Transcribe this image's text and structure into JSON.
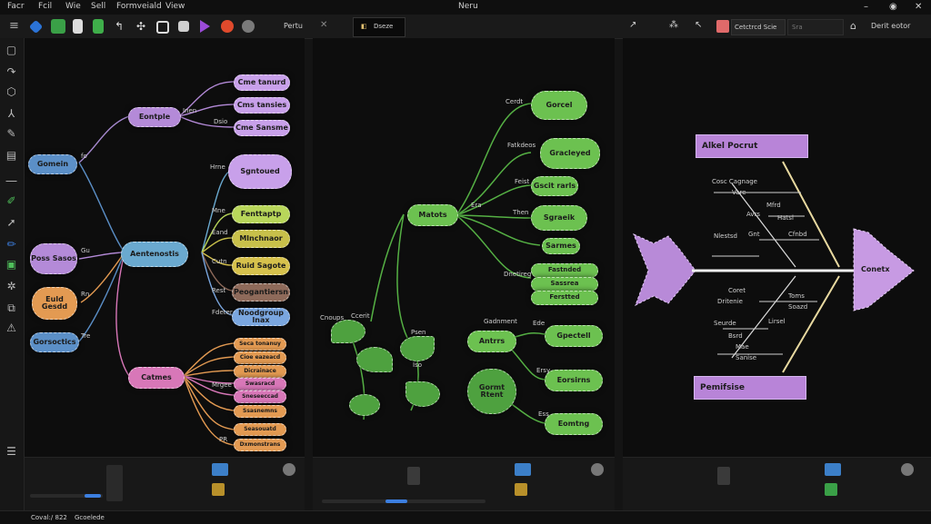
{
  "window": {
    "title": "Neru"
  },
  "menu": [
    "Facr",
    "Fcil",
    "Wie",
    "Sell",
    "Formveiald",
    "View"
  ],
  "toolbar": {
    "left_tab_label": "Pertu",
    "mid_tab_label": "Dseze",
    "right_search_label": "Cetctrcd Scie",
    "right_field_label": "Sra",
    "right_action_label": "Derit eotor"
  },
  "colors": {
    "background": "#0d0d0d",
    "purple": "#b48ad8",
    "green": "#6cc150",
    "orange": "#e39a52",
    "blue": "#5b8fc7",
    "fishbone": "#c79ae3"
  },
  "panel1": {
    "nodes": {
      "left_root": "Gomein",
      "center": "Aentenostis",
      "top": "Eontple",
      "top_leaf1": "Cme tanurd",
      "top_leaf2": "Cms tansies",
      "top_leaf3": "Cme Sansme",
      "cloud": "Sgntoued",
      "mid1": "Fenttaptp",
      "mid2": "Mlnchnaor",
      "mid3": "Ruid Sagote",
      "mid4": "Peogantiersn",
      "mid5": "Noodgroup lnax",
      "left2": "Poss Sasos",
      "left3": "Euld Gesdd",
      "left4": "Gorsoctics",
      "bottom": "Catmes",
      "b1": "Seca tonanuy",
      "b2": "Cioe eazeacd",
      "b3": "Dicrainace",
      "b4": "Swasracd",
      "b5": "Sneseeccad",
      "b6": "Ssasnemns",
      "b7": "Seasouatd",
      "b8": "Dxmonstrans"
    },
    "labels": [
      "fo",
      "Inen",
      "Dsio",
      "Hrne",
      "Mne",
      "Eand",
      "Cutn",
      "Rest",
      "Fdeter",
      "Gu",
      "Rn",
      "Mrgee",
      "Tre",
      "PR"
    ]
  },
  "panel2": {
    "nodes": {
      "center": "Matots",
      "r1": "Gorcel",
      "r2": "Gracleyed",
      "r3": "Gscit rarls",
      "r4": "Sgraeik",
      "r5": "Sarmes",
      "r6a": "Fastnded",
      "r6b": "Sassrea",
      "r6c": "Ferstted",
      "lower_left": "Antrrs",
      "lower_left2": "Gormt Rtent",
      "lr1": "Gpectell",
      "lr2": "Eorsirns",
      "lr3": "Eomtng"
    },
    "labels": [
      "Cerdt",
      "Fatkdeos",
      "Feist",
      "Then",
      "Dnetireg",
      "Era",
      "Gadnment",
      "Ede",
      "Ersy",
      "Cnoups",
      "Ccerit",
      "Psen",
      "Iso",
      "Ess"
    ]
  },
  "panel3": {
    "fish_head_label": "Conetx",
    "boxes": {
      "top": "Alkel Pocrut",
      "bottom": "Pemifsise"
    },
    "cause_labels": [
      "Cosc Cagnage",
      "Vare",
      "Mfrd",
      "Avrs",
      "Hatsl",
      "Nlestsd",
      "Gnt",
      "Cfnbd",
      "Coret",
      "Dritenie",
      "Toms",
      "Soazd",
      "Seurde",
      "Lirsel",
      "Bsrd",
      "Mae",
      "Sanise"
    ]
  },
  "status": {
    "left": "Coval:/ 822",
    "left2": "Gcoelede"
  }
}
